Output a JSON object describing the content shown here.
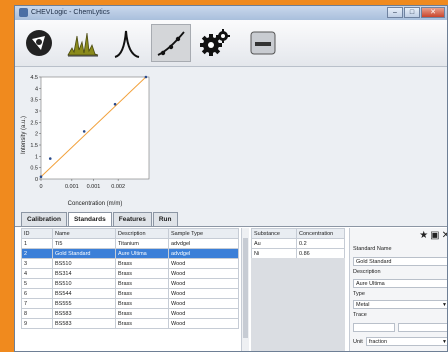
{
  "window": {
    "title": "CHEVLogic - ChemLytics"
  },
  "toolbar": {
    "items": [
      "logo",
      "spectra",
      "analyze",
      "calibrate",
      "settings",
      "storage"
    ],
    "active": "calibrate"
  },
  "chart_data": {
    "type": "scatter",
    "x": [
      0,
      0.0003,
      0.0014,
      0.0024,
      0.0034
    ],
    "y": [
      0.1,
      0.9,
      2.1,
      3.3,
      4.5
    ],
    "fit_line": true,
    "xlim": [
      0,
      0.0035
    ],
    "ylim": [
      0,
      4.5
    ],
    "yticks": [
      "0",
      "0.5",
      "1",
      "1.5",
      "2",
      "2.5",
      "3",
      "3.5",
      "4",
      "4.5"
    ],
    "xticks": [
      "0",
      "0.001",
      "0.001",
      "0.002"
    ],
    "xlabel": "Concentration (m/m)",
    "ylabel": "Intensity (a.u.)",
    "colors": {
      "points": "#2a4a8a",
      "fit": "#f2a13b"
    }
  },
  "tabs": [
    "Calibration",
    "Standards",
    "Features",
    "Run"
  ],
  "active_tab": "Standards",
  "standards": {
    "columns": [
      "ID",
      "Name",
      "Description",
      "Sample Type"
    ],
    "rows": [
      [
        "1",
        "Ti5",
        "Titanium",
        "advdgel"
      ],
      [
        "2",
        "Gold Standard",
        "Aure Ultima",
        "advdgel"
      ],
      [
        "3",
        "BS510",
        "Brass",
        "Wood"
      ],
      [
        "4",
        "BS314",
        "Brass",
        "Wood"
      ],
      [
        "5",
        "BS510",
        "Brass",
        "Wood"
      ],
      [
        "6",
        "BS544",
        "Brass",
        "Wood"
      ],
      [
        "7",
        "BS555",
        "Brass",
        "Wood"
      ],
      [
        "8",
        "BS583",
        "Brass",
        "Wood"
      ],
      [
        "9",
        "BS583",
        "Brass",
        "Wood"
      ]
    ],
    "selected_index": 1
  },
  "substances": {
    "columns": [
      "Substance",
      "Concentration"
    ],
    "rows": [
      [
        "Au",
        "0.2"
      ],
      [
        "Ni",
        "0.86"
      ]
    ]
  },
  "detail": {
    "name_label": "Standard Name",
    "name_value": "Gold Standard",
    "desc_label": "Description",
    "desc_value": "Aure Ultima",
    "type_label": "Type",
    "type_value": "Metal",
    "trace_label": "Trace",
    "unit_label": "Unit",
    "unit_value": "fraction"
  }
}
